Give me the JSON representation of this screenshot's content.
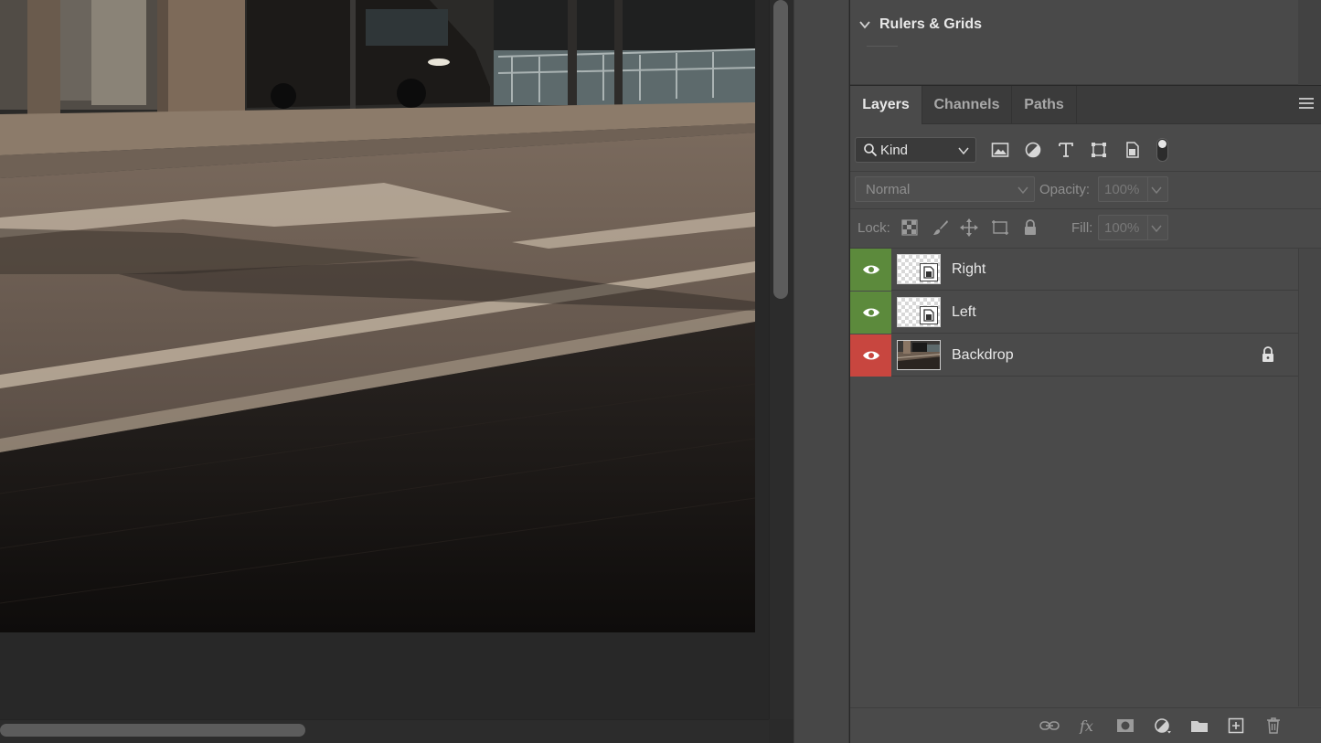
{
  "rulers_panel": {
    "title": "Rulers & Grids"
  },
  "layers_panel": {
    "tabs": [
      {
        "label": "Layers",
        "active": true
      },
      {
        "label": "Channels",
        "active": false
      },
      {
        "label": "Paths",
        "active": false
      }
    ],
    "filter": {
      "kind_label": "Kind",
      "icons": [
        "image-filter-icon",
        "adjustment-filter-icon",
        "type-filter-icon",
        "shape-filter-icon",
        "smart-object-filter-icon"
      ]
    },
    "blend_mode": "Normal",
    "opacity_label": "Opacity:",
    "opacity_value": "100%",
    "lock_label": "Lock:",
    "fill_label": "Fill:",
    "fill_value": "100%",
    "layers": [
      {
        "name": "Right",
        "eye_color": "#5c8a3c",
        "type": "smart-object",
        "locked": false
      },
      {
        "name": "Left",
        "eye_color": "#5c8a3c",
        "type": "smart-object",
        "locked": false
      },
      {
        "name": "Backdrop",
        "eye_color": "#c8463f",
        "type": "image",
        "locked": true
      }
    ]
  },
  "colors": {
    "accent_green": "#5c8a3c",
    "accent_red": "#c8463f"
  }
}
